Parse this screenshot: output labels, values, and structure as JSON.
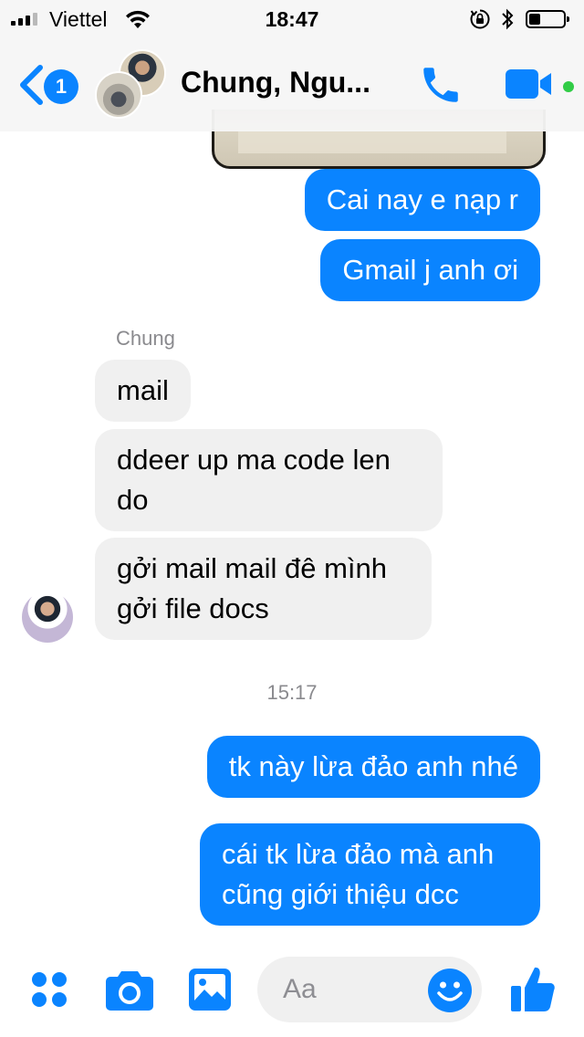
{
  "status_bar": {
    "carrier": "Viettel",
    "time": "18:47"
  },
  "header": {
    "back_badge": "1",
    "title": "Chung, Ngu..."
  },
  "messages": [
    {
      "from": "me",
      "text": "Cai nay e nạp r"
    },
    {
      "from": "me",
      "text": "Gmail j anh ơi"
    },
    {
      "from": "them",
      "text": "mail"
    },
    {
      "from": "them",
      "text": "ddeer up ma code len do"
    },
    {
      "from": "them",
      "text": "gởi mail mail đê mình gởi file docs"
    },
    {
      "from": "me",
      "text": "tk này lừa đảo anh nhé"
    },
    {
      "from": "me",
      "text": "cái tk lừa đảo mà anh cũng giới thiệu dcc"
    }
  ],
  "sender_name": "Chung",
  "time_separator": "15:17",
  "composer": {
    "placeholder": "Aa"
  },
  "colors": {
    "accent": "#0a84ff",
    "incoming_bubble": "#f0f0f0",
    "active_status": "#31cc46"
  },
  "icons": [
    "more-apps-icon",
    "camera-icon",
    "gallery-icon",
    "emoji-icon",
    "thumbs-up-icon",
    "phone-icon",
    "video-call-icon",
    "back-chevron-icon",
    "wifi-icon",
    "bluetooth-icon",
    "orientation-lock-icon",
    "battery-icon"
  ]
}
